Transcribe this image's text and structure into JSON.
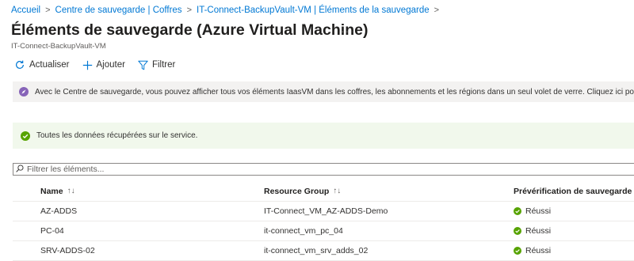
{
  "breadcrumb": {
    "items": [
      "Accueil",
      "Centre de sauvegarde | Coffres",
      "IT-Connect-BackupVault-VM | Éléments de la sauvegarde"
    ],
    "separator": ">"
  },
  "page": {
    "title": "Éléments de sauvegarde (Azure Virtual Machine)",
    "more": "···",
    "subtitle": "IT-Connect-BackupVault-VM"
  },
  "toolbar": {
    "refresh_label": "Actualiser",
    "add_label": "Ajouter",
    "filter_label": "Filtrer"
  },
  "info_banner": {
    "text": "Avec le Centre de sauvegarde, vous pouvez afficher tous vos éléments IaasVM dans les coffres, les abonnements et les régions dans un seul volet de verre. Cliquez ici pour utiliser la nouvelle"
  },
  "success_banner": {
    "text": "Toutes les données récupérées sur le service."
  },
  "filter": {
    "placeholder": "Filtrer les éléments..."
  },
  "table": {
    "headers": {
      "name": "Name",
      "resource_group": "Resource Group",
      "precheck": "Prévérification de sauvegarde"
    },
    "sort_glyph": "↑↓",
    "rows": [
      {
        "name": "AZ-ADDS",
        "resource_group": "IT-Connect_VM_AZ-ADDS-Demo",
        "status": "Réussi"
      },
      {
        "name": "PC-04",
        "resource_group": "it-connect_vm_pc_04",
        "status": "Réussi"
      },
      {
        "name": "SRV-ADDS-02",
        "resource_group": "it-connect_vm_srv_adds_02",
        "status": "Réussi"
      }
    ]
  },
  "colors": {
    "link": "#0078d4",
    "success": "#57a300",
    "info_icon": "#8764b8"
  }
}
